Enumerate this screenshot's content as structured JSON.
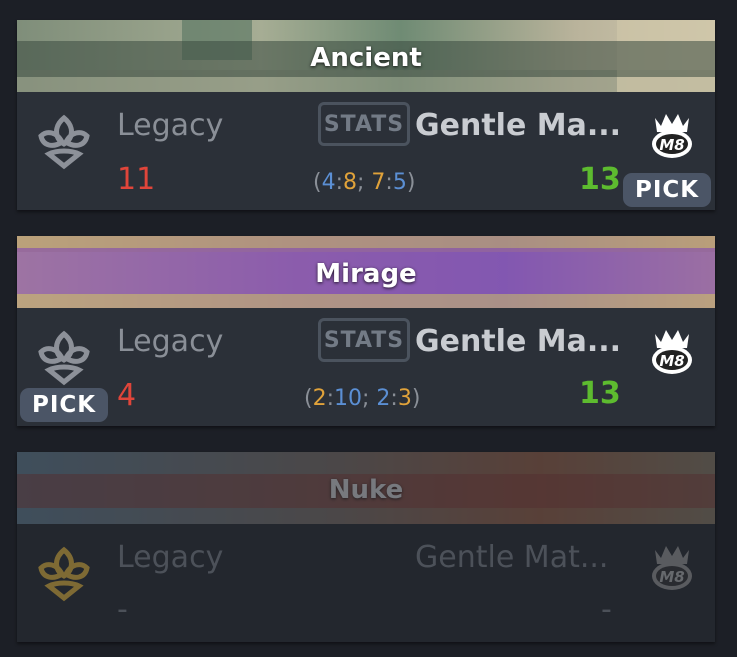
{
  "colors": {
    "background": "#1c1f26",
    "card": "#2b3038",
    "loss": "#e0453a",
    "win": "#5dbb2f",
    "ct": "#5b8fd4",
    "t": "#e0a23a",
    "pick_badge": "#4b5566"
  },
  "maps": [
    {
      "map_name": "Ancient",
      "left_team": "Legacy",
      "right_team": "Gentle Ma...",
      "left_score": "11",
      "right_score": "13",
      "stats_label": "STATS",
      "halves": {
        "h1_ct": "4",
        "h1_t": "8",
        "h2_t": "7",
        "h2_ct": "5"
      },
      "pick_label": "PICK",
      "picked_by": "right",
      "played": true
    },
    {
      "map_name": "Mirage",
      "left_team": "Legacy",
      "right_team": "Gentle Ma...",
      "left_score": "4",
      "right_score": "13",
      "stats_label": "STATS",
      "halves": {
        "h1_t": "2",
        "h1_ct": "10",
        "h2_ct": "2",
        "h2_t": "3"
      },
      "pick_label": "PICK",
      "picked_by": "left",
      "played": true
    },
    {
      "map_name": "Nuke",
      "left_team": "Legacy",
      "right_team": "Gentle Mat...",
      "left_score": "-",
      "right_score": "-",
      "played": false
    }
  ],
  "icons": {
    "left_team_logo": "legacy-logo-icon",
    "right_team_logo": "m8-logo-icon"
  }
}
